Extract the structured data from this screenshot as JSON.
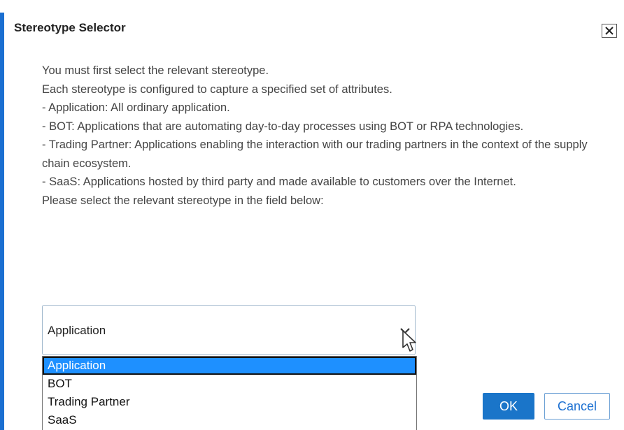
{
  "dialog": {
    "title": "Stereotype Selector",
    "close_icon": "close-icon",
    "accent_color": "#1a6fd1"
  },
  "body": {
    "lines": [
      "You must first select the relevant stereotype.",
      "Each stereotype is configured to capture a specified set of attributes.",
      "- Application: All ordinary application.",
      "- BOT: Applications that are automating day-to-day processes using BOT or RPA technologies.",
      "- Trading Partner: Applications enabling the interaction with our trading partners in the context of the supply chain ecosystem.",
      "- SaaS: Applications hosted by third party and made available to customers over the Internet.",
      "Please select the relevant stereotype in the field below:"
    ]
  },
  "select": {
    "value": "Application",
    "chevron_icon": "chevron-down-icon",
    "options": [
      "Application",
      "BOT",
      "Trading Partner",
      "SaaS"
    ],
    "selected_index": 0,
    "highlight_color": "#1e90ff"
  },
  "buttons": {
    "ok_label": "OK",
    "cancel_label": "Cancel",
    "ok_color": "#1a75c9"
  }
}
